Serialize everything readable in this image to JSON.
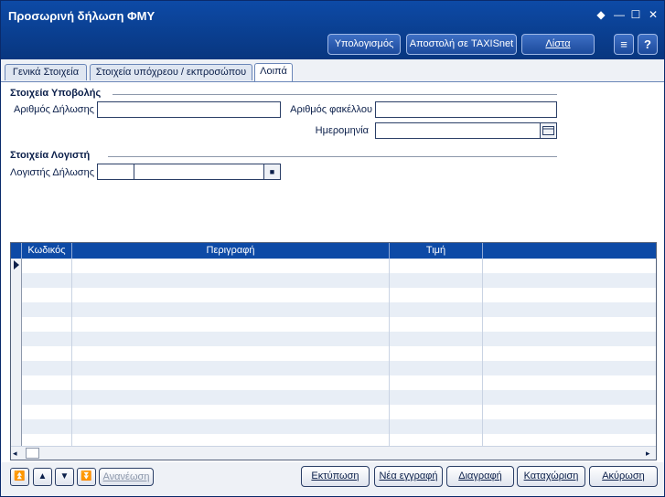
{
  "window": {
    "title": "Προσωρινή δήλωση ΦΜΥ"
  },
  "toolbar": {
    "calc_label": "Υπολογισμός",
    "send_label": "Αποστολή σε TAXISnet",
    "list_label": "Λίστα"
  },
  "tabs": [
    {
      "label": "Γενικά Στοιχεία"
    },
    {
      "label": "Στοιχεία υπόχρεου / εκπροσώπου"
    },
    {
      "label": "Λοιπά"
    }
  ],
  "submission": {
    "section_title": "Στοιχεία Υποβολής",
    "declaration_no_label": "Αριθμός Δήλωσης",
    "declaration_no_value": "",
    "file_no_label": "Αριθμός φακέλλου",
    "file_no_value": "",
    "date_label": "Ημερομηνία",
    "date_value": ""
  },
  "accountant": {
    "section_title": "Στοιχεία Λογιστή",
    "accountant_label": "Λογιστής Δήλωσης",
    "code_value": "",
    "name_value": ""
  },
  "grid": {
    "columns": [
      "Κωδικός",
      "Περιγραφή",
      "Τιμή",
      ""
    ]
  },
  "bottom": {
    "refresh_label": "Ανανέωση",
    "print_label": "Εκτύπωση",
    "new_label": "Νέα εγγραφή",
    "delete_label": "Διαγραφή",
    "save_label": "Καταχώριση",
    "cancel_label": "Ακύρωση"
  }
}
